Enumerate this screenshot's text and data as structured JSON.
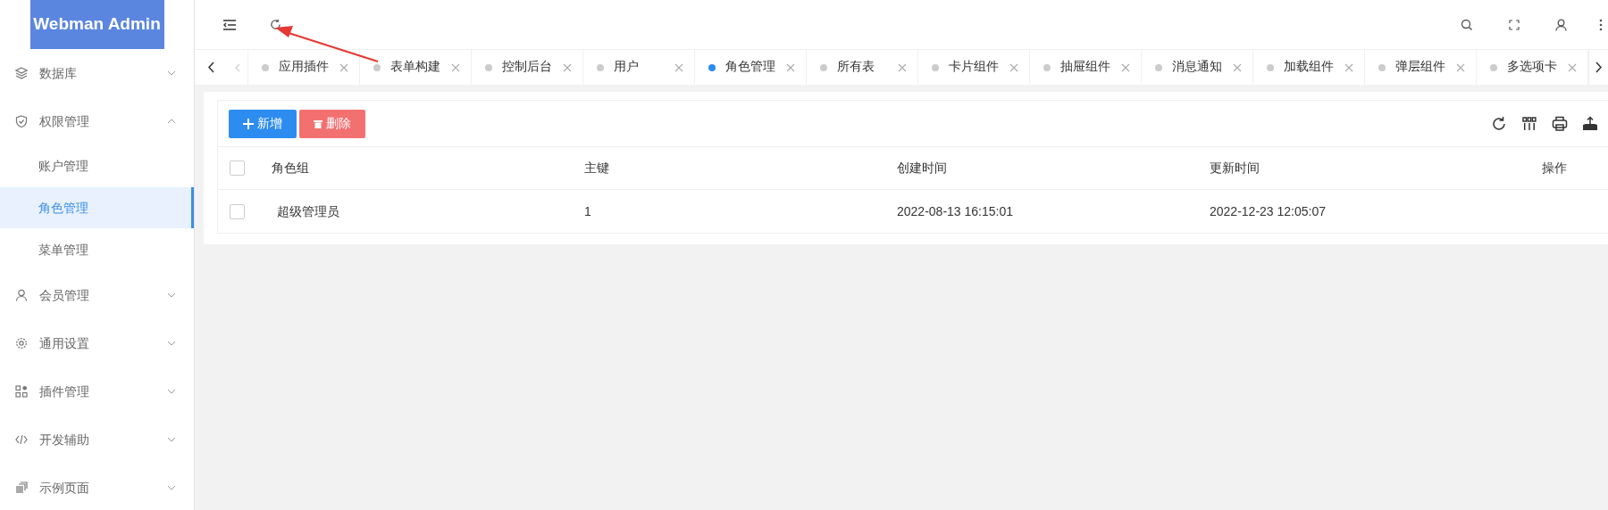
{
  "logo": {
    "title": "Webman Admin"
  },
  "sidebar": {
    "items": [
      {
        "label": "数据库",
        "expanded": false
      },
      {
        "label": "权限管理",
        "expanded": true,
        "children": [
          {
            "label": "账户管理",
            "selected": false
          },
          {
            "label": "角色管理",
            "selected": true
          },
          {
            "label": "菜单管理",
            "selected": false
          }
        ]
      },
      {
        "label": "会员管理",
        "expanded": false
      },
      {
        "label": "通用设置",
        "expanded": false
      },
      {
        "label": "插件管理",
        "expanded": false
      },
      {
        "label": "开发辅助",
        "expanded": false
      },
      {
        "label": "示例页面",
        "expanded": false
      }
    ]
  },
  "tabs": [
    {
      "label": "应用插件",
      "selected": false
    },
    {
      "label": "表单构建",
      "selected": false
    },
    {
      "label": "控制后台",
      "selected": false
    },
    {
      "label": "用户",
      "selected": false
    },
    {
      "label": "角色管理",
      "selected": true
    },
    {
      "label": "所有表",
      "selected": false
    },
    {
      "label": "卡片组件",
      "selected": false
    },
    {
      "label": "抽屉组件",
      "selected": false
    },
    {
      "label": "消息通知",
      "selected": false
    },
    {
      "label": "加载组件",
      "selected": false
    },
    {
      "label": "弹层组件",
      "selected": false
    },
    {
      "label": "多选项卡",
      "selected": false
    }
  ],
  "toolbar": {
    "buttons": [
      {
        "label": "新增",
        "kind": "add"
      },
      {
        "label": "删除",
        "kind": "delete"
      }
    ]
  },
  "table": {
    "header_checked": false,
    "columns": [
      "角色组",
      "主键",
      "创建时间",
      "更新时间",
      "操作"
    ],
    "rows": [
      {
        "selected": false,
        "cells": [
          "超级管理员",
          "1",
          "2022-08-13 16:15:01",
          "2022-12-23 12:05:07"
        ]
      }
    ]
  }
}
